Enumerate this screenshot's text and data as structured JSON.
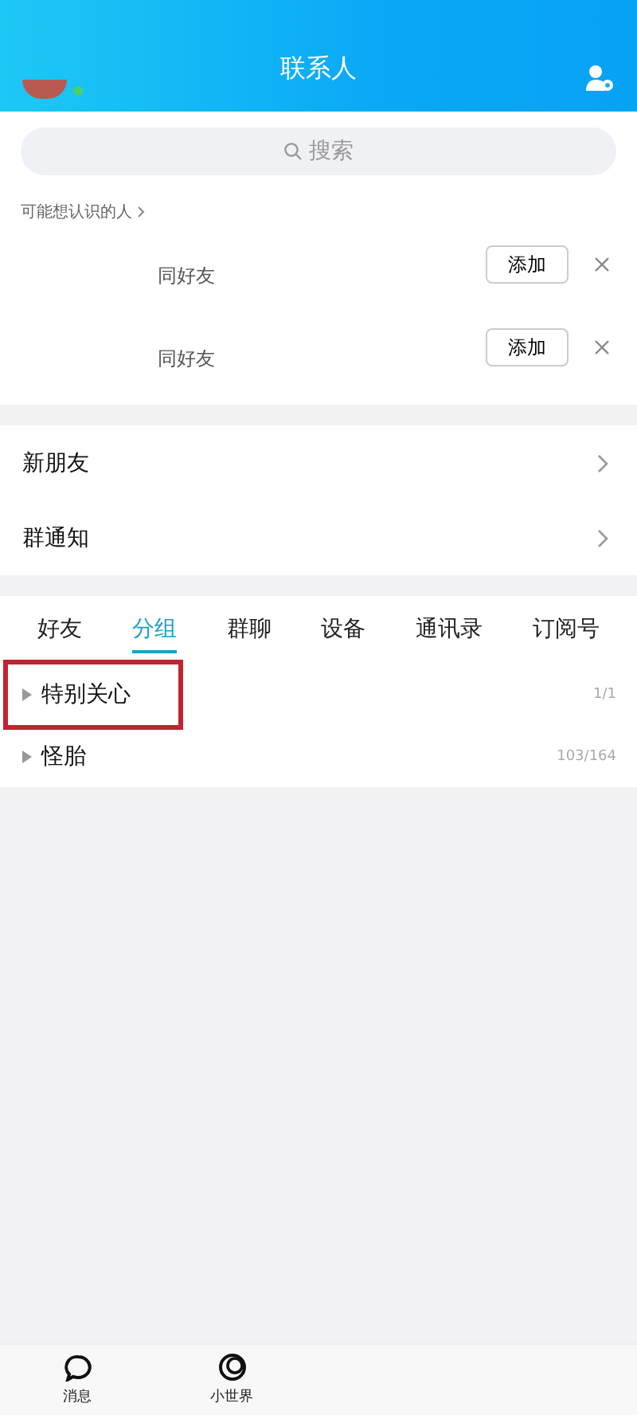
{
  "header": {
    "title": "联系人"
  },
  "search": {
    "placeholder": "搜索"
  },
  "suggestions": {
    "label": "可能想认识的人",
    "people": [
      {
        "subtitle": "同好友",
        "button": "添加"
      },
      {
        "subtitle": "同好友",
        "button": "添加"
      }
    ]
  },
  "entries": [
    {
      "label": "新朋友"
    },
    {
      "label": "群通知"
    }
  ],
  "tabs": [
    {
      "label": "好友",
      "selected": false
    },
    {
      "label": "分组",
      "selected": true
    },
    {
      "label": "群聊",
      "selected": false
    },
    {
      "label": "设备",
      "selected": false
    },
    {
      "label": "通讯录",
      "selected": false
    },
    {
      "label": "订阅号",
      "selected": false
    }
  ],
  "groups": [
    {
      "name": "特别关心",
      "count": "1/1",
      "highlighted": true
    },
    {
      "name": "怪胎",
      "count": "103/164",
      "highlighted": false
    }
  ],
  "bottom_nav": [
    {
      "label": "消息",
      "kind": "chat"
    },
    {
      "label": "小世界",
      "kind": "world"
    }
  ]
}
